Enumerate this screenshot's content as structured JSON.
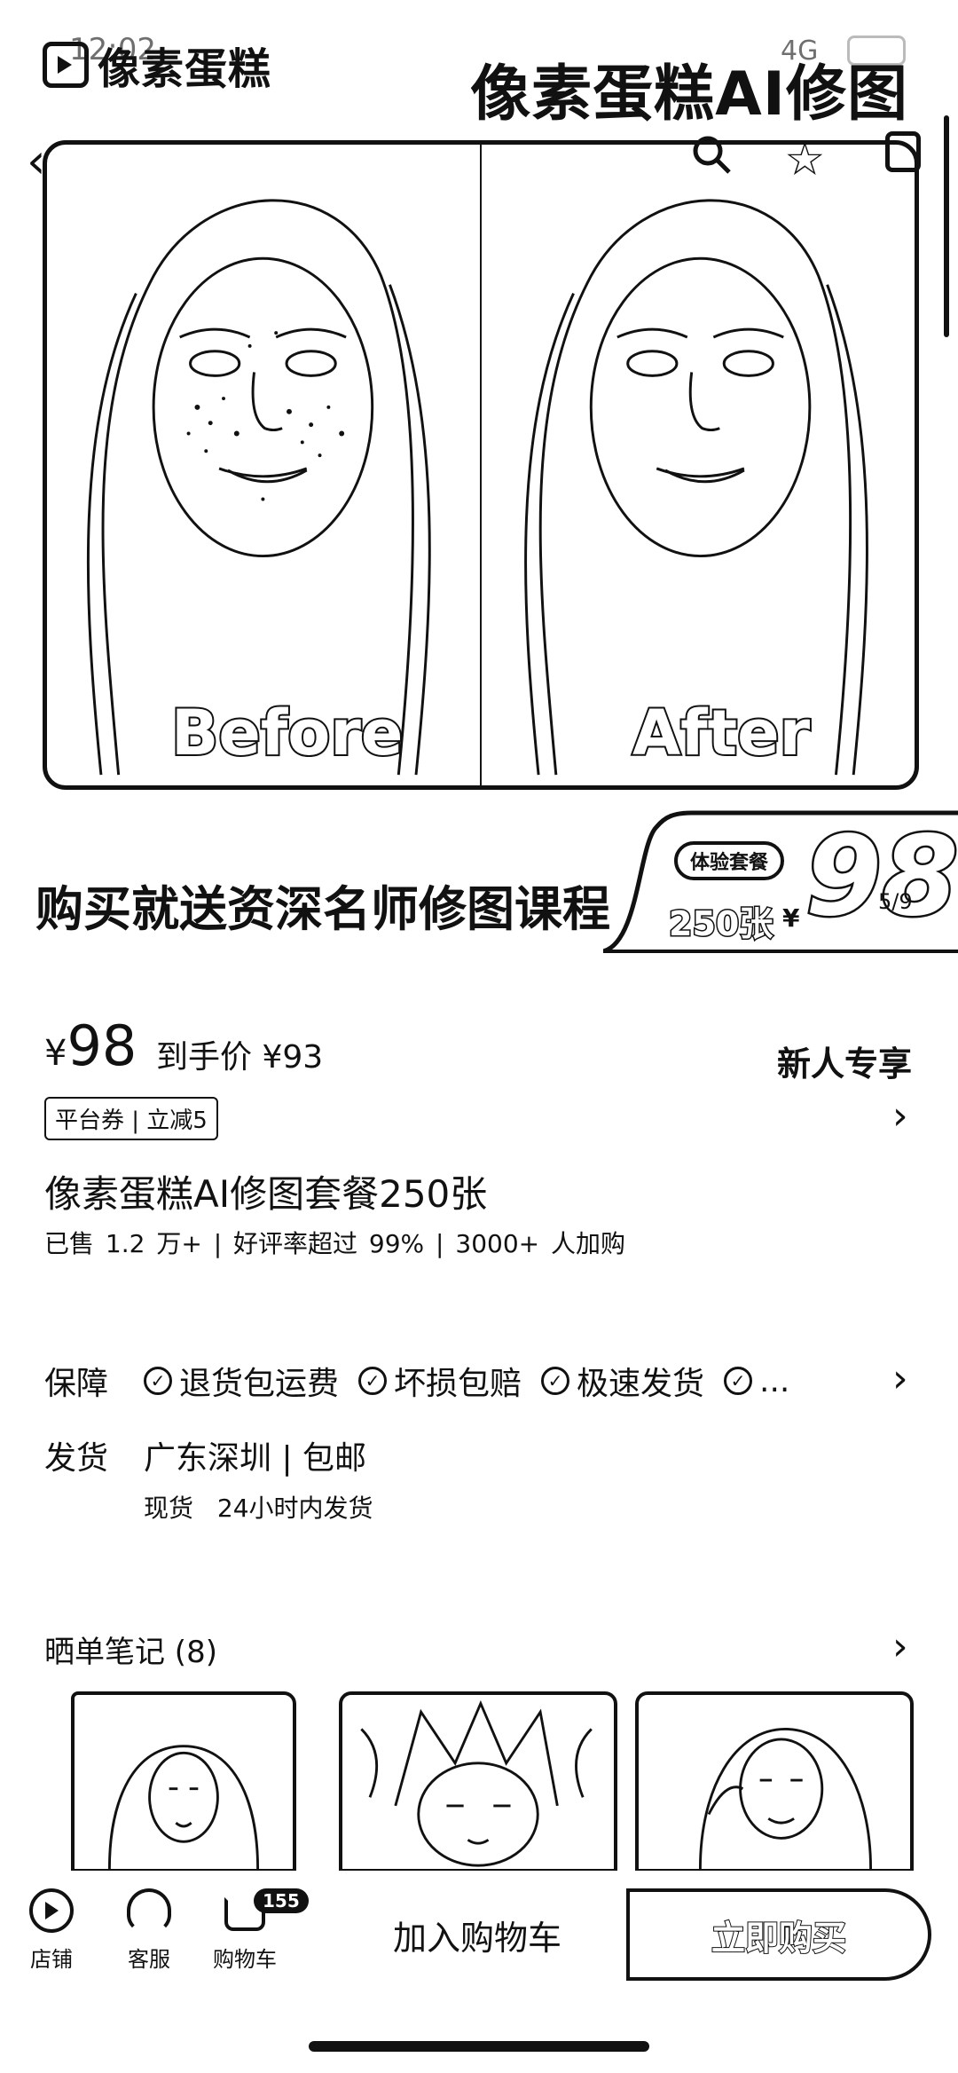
{
  "status_bar": {
    "time": "12:02",
    "network": "4G"
  },
  "shop": {
    "name": "像素蛋糕"
  },
  "hero": {
    "banner_title": "像素蛋糕AI修图",
    "before_label": "Before",
    "after_label": "After"
  },
  "promo": {
    "text": "购买就送资深名师修图课程",
    "package_tag": "体验套餐",
    "count": "250张",
    "currency": "¥",
    "price": "98",
    "page_indicator": "5/9"
  },
  "pricing": {
    "currency": "¥",
    "price": "98",
    "final_price_text": "到手价 ¥93",
    "newbie_text": "新人专享",
    "coupon_text": "平台券 | 立减5"
  },
  "product": {
    "title": "像素蛋糕AI修图套餐250张",
    "stats": "已售 1.2 万+ | 好评率超过 99% | 3000+ 人加购"
  },
  "guarantee": {
    "label": "保障",
    "items": [
      "退货包运费",
      "坏损包赔",
      "极速发货",
      "..."
    ]
  },
  "shipping": {
    "label": "发货",
    "location": "广东深圳 | 包邮",
    "detail": "现货 24小时内发货"
  },
  "notes": {
    "title": "晒单笔记 (8)"
  },
  "bottom_bar": {
    "shop": "店铺",
    "service": "客服",
    "cart": "购物车",
    "cart_badge": "155",
    "add_to_cart": "加入购物车",
    "buy_now": "立即购买"
  }
}
